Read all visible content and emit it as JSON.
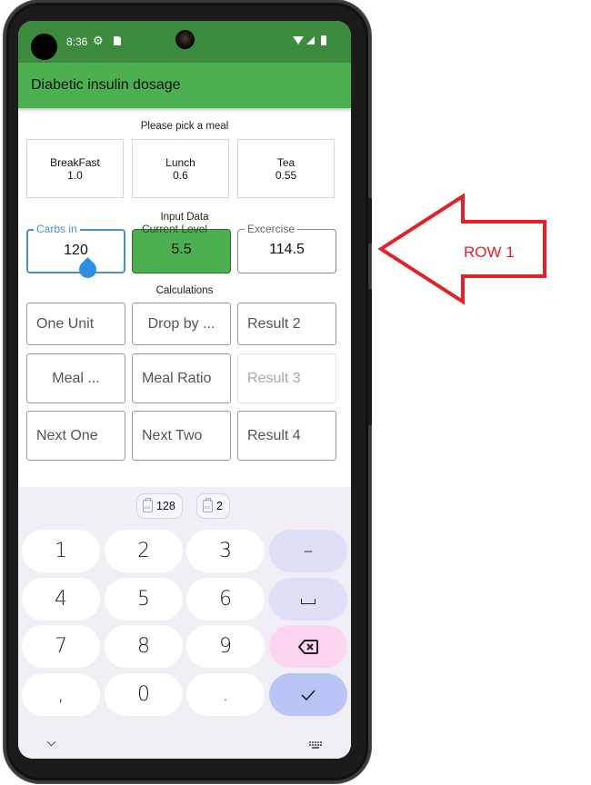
{
  "status_bar": {
    "time": "8:36",
    "icons": [
      "settings-gear-icon",
      "sd-card-icon",
      "wifi-icon",
      "cell-signal-icon",
      "battery-icon"
    ]
  },
  "app_bar": {
    "title": "Diabetic insulin dosage"
  },
  "meal_section": {
    "label": "Please pick a meal",
    "meals": [
      {
        "name": "BreakFast",
        "ratio": "1.0"
      },
      {
        "name": "Lunch",
        "ratio": "0.6"
      },
      {
        "name": "Tea",
        "ratio": "0.55"
      }
    ]
  },
  "input_section": {
    "label": "Input Data",
    "fields": [
      {
        "label": "Carbs in",
        "value": "120",
        "state": "focused"
      },
      {
        "label": "Current Level",
        "value": "5.5",
        "state": "highlighted"
      },
      {
        "label": "Excercise",
        "value": "114.5",
        "state": "normal"
      }
    ]
  },
  "calculations": {
    "label": "Calculations",
    "rows": [
      [
        "One Unit",
        "Drop by ...",
        "Result 2"
      ],
      [
        "Meal ...",
        "Meal Ratio",
        "Result 3"
      ],
      [
        "Next One",
        "Next Two",
        "Result 4"
      ]
    ]
  },
  "keyboard": {
    "suggestions": [
      "128",
      "2"
    ],
    "keys": [
      [
        "1",
        "2",
        "3",
        "–"
      ],
      [
        "4",
        "5",
        "6",
        "␣"
      ],
      [
        "7",
        "8",
        "9",
        "⌫"
      ],
      [
        ",",
        "0",
        ".",
        "✓"
      ]
    ],
    "colors": {
      "function_key": "#dfe0f7",
      "delete_key": "#fbd6ee",
      "done_key": "#bac5f6"
    }
  },
  "annotation": {
    "label": "ROW 1",
    "color": "#e52128"
  },
  "theme": {
    "status_bar": "#3b8a3e",
    "app_bar": "#4caf50",
    "focus": "#4a90c8"
  }
}
